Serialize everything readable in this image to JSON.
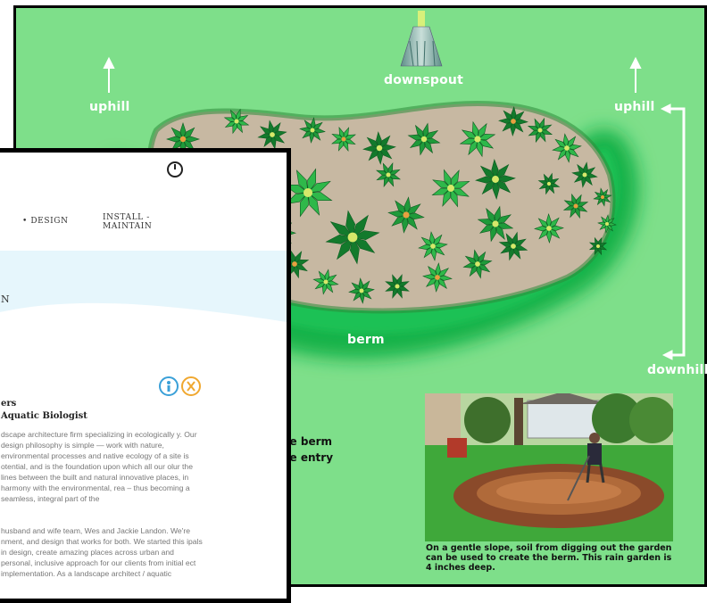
{
  "diagram": {
    "labels": {
      "downspout": "downspout",
      "uphill_left": "uphill",
      "uphill_right": "uphill",
      "berm": "berm",
      "downhill": "downhill"
    },
    "partial_text_lines": [
      "he berm",
      "he entry"
    ],
    "photo_caption": "On a gentle slope, soil from digging out the garden can be used to create the berm. This rain garden is 4 inches deep.",
    "colors": {
      "lawn": "#7edf8a",
      "berm": "#22c45a",
      "bed": "#c7b8a2",
      "frame": "#000000"
    }
  },
  "webpage": {
    "nav": {
      "design": "• DESIGN",
      "install_line1": "INSTALL -",
      "install_line2": "MAINTAIN"
    },
    "hero_letter": "N",
    "heading_line1": "ers",
    "heading_line2": "Aquatic Biologist",
    "paragraph1": "dscape architecture firm specializing in ecologically y. Our design philosophy is simple — work with nature, environmental processes and native ecology of a site is otential, and is the foundation upon which all our olur the lines between the built and natural innovative places, in harmony with the environmental, rea – thus becoming a seamless, integral part of the",
    "paragraph2": "husband and wife team, Wes and Jackie Landon. We're nment, and design that works for both. We started this ipals in design, create amazing places across urban and personal, inclusive approach for our clients from initial ect implementation. As a landscape architect / aquatic"
  }
}
